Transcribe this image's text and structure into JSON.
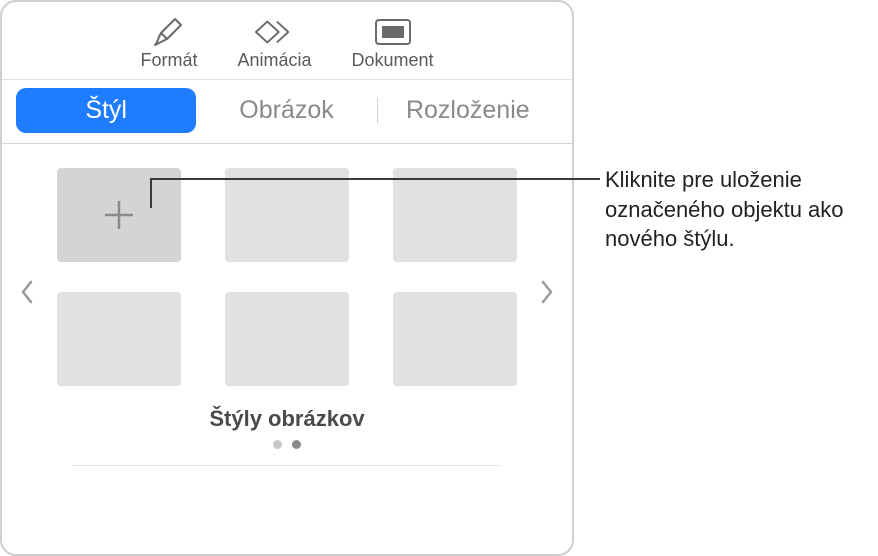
{
  "toolbar": {
    "format": "Formát",
    "animation": "Animácia",
    "document": "Dokument"
  },
  "tabs": {
    "style": "Štýl",
    "image": "Obrázok",
    "layout": "Rozloženie"
  },
  "styles": {
    "caption": "Štýly obrázkov"
  },
  "callout": {
    "text": "Kliknite pre uloženie označeného objektu ako nového štýlu."
  }
}
